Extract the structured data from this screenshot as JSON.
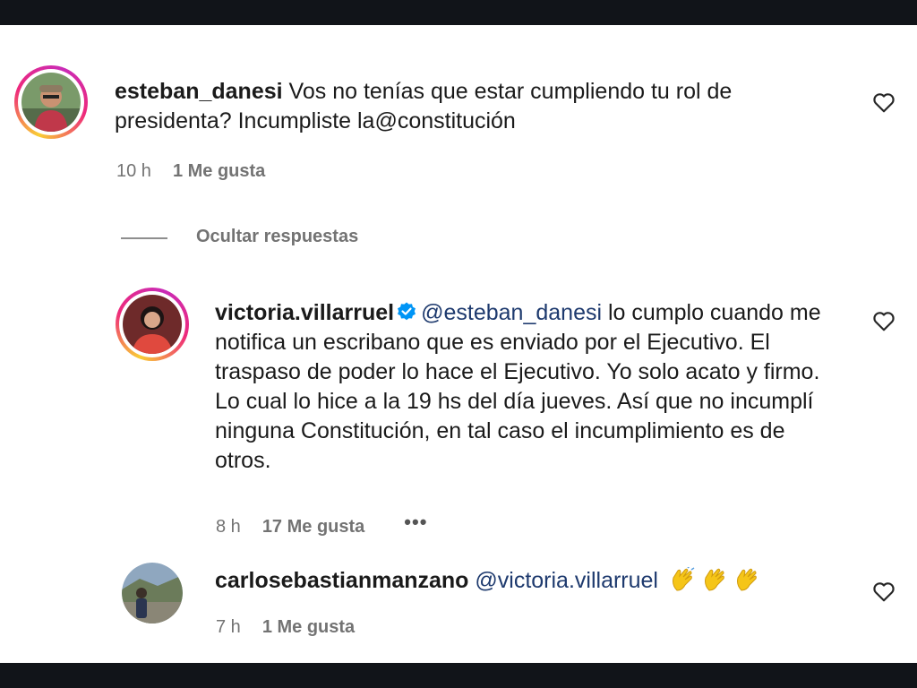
{
  "comments": [
    {
      "username": "esteban_danesi",
      "text": "Vos no tenías que estar cumpliendo tu rol de presidenta? Incumpliste la@constitución",
      "time": "10 h",
      "likes": "1 Me gusta"
    },
    {
      "username": "victoria.villarruel",
      "mention": "@esteban_danesi",
      "text": " lo cumplo cuando me notifica un escribano que es enviado por el Ejecutivo. El traspaso de poder lo hace el Ejecutivo. Yo solo acato y firmo. Lo cual lo hice a la 19 hs del día jueves. Así que no incumplí ninguna Constitución, en tal caso el incumplimiento es de otros.",
      "time": "8 h",
      "likes": "17 Me gusta",
      "more": "•••"
    },
    {
      "username": "carlosebastianmanzano",
      "mention": "@victoria.villarruel",
      "time": "7 h",
      "likes": "1 Me gusta"
    }
  ],
  "replies_toggle": "Ocultar respuestas",
  "colors": {
    "mention": "#1e3a6e",
    "meta": "#737373",
    "verified": "#0095f6",
    "clap": "#f5c518"
  }
}
